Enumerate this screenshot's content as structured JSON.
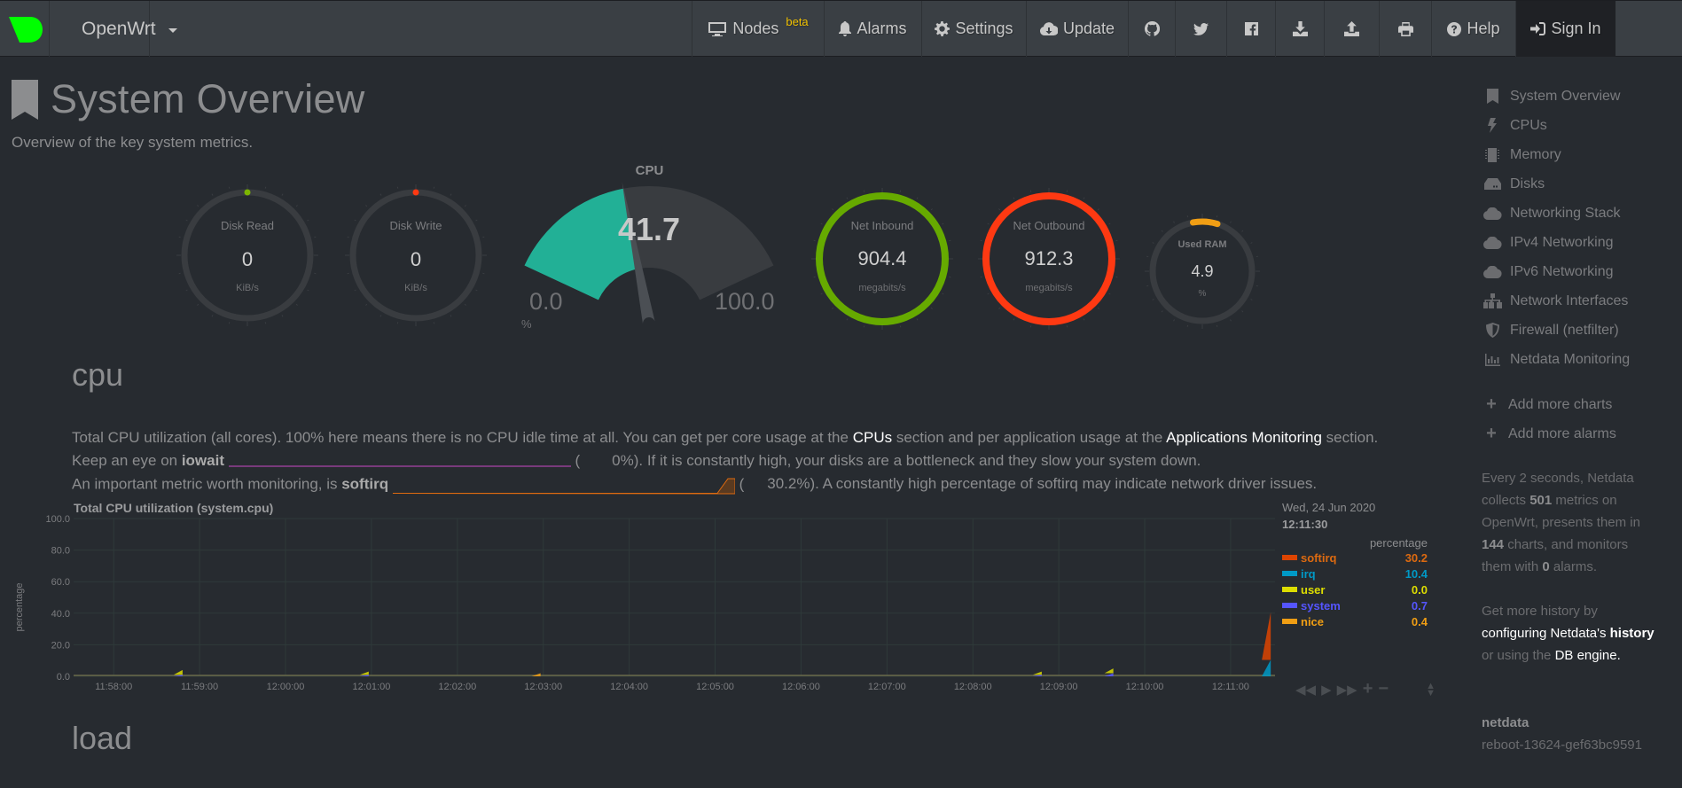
{
  "navbar": {
    "brand": "OpenWrt",
    "items": [
      {
        "label": "Nodes",
        "badge": "beta",
        "icon": "monitor-icon"
      },
      {
        "label": "Alarms",
        "icon": "bell-icon"
      },
      {
        "label": "Settings",
        "icon": "gear-icon"
      },
      {
        "label": "Update",
        "icon": "cloud-download-icon"
      },
      {
        "label": "",
        "icon": "github-icon"
      },
      {
        "label": "",
        "icon": "twitter-icon"
      },
      {
        "label": "",
        "icon": "facebook-icon"
      },
      {
        "label": "",
        "icon": "download-icon"
      },
      {
        "label": "",
        "icon": "upload-icon"
      },
      {
        "label": "",
        "icon": "print-icon"
      },
      {
        "label": "Help",
        "icon": "question-circle-icon"
      },
      {
        "label": "Sign In",
        "icon": "sign-in-icon"
      }
    ]
  },
  "page": {
    "title": "System Overview",
    "subtitle": "Overview of the key system metrics."
  },
  "gauges": {
    "disk_read": {
      "label": "Disk Read",
      "value": "0",
      "unit": "KiB/s",
      "color": "#7cb600"
    },
    "disk_write": {
      "label": "Disk Write",
      "value": "0",
      "unit": "KiB/s",
      "color": "#fe3912"
    },
    "cpu": {
      "label": "CPU",
      "value": "41.7",
      "min": "0.0",
      "max": "100.0",
      "unit": "%",
      "fraction": 0.417,
      "color": "#22b096"
    },
    "net_inbound": {
      "label": "Net Inbound",
      "value": "904.4",
      "unit": "megabits/s",
      "color": "#66aa00"
    },
    "net_outbound": {
      "label": "Net Outbound",
      "value": "912.3",
      "unit": "megabits/s",
      "color": "#fe3912"
    },
    "used_ram": {
      "label": "Used RAM",
      "value": "4.9",
      "unit": "%",
      "fraction": 0.049,
      "color": "#f09e14"
    }
  },
  "cpu_section": {
    "heading": "cpu",
    "desc_line1_a": "Total CPU utilization (all cores). 100% here means there is no CPU idle time at all. You can get per core usage at the ",
    "desc_link_cpus": "CPUs",
    "desc_line1_b": " section and per application usage at the ",
    "desc_link_apps": "Applications Monitoring",
    "desc_line1_c": " section.",
    "desc_line2_a": "Keep an eye on ",
    "desc_line2_b": "iowait",
    "desc_line2_paren_open": "(",
    "desc_line2_val": "0%). If it is constantly high, your disks are a bottleneck and they slow your system down.",
    "desc_line3_a": "An important metric worth monitoring, is ",
    "desc_line3_b": "softirq",
    "desc_line3_paren_open": "(",
    "desc_line3_val": "30.2%). A constantly high percentage of softirq may indicate network driver issues."
  },
  "chart_data": {
    "type": "area",
    "title": "Total CPU utilization (system.cpu)",
    "ylabel": "percentage",
    "xlabel": "",
    "ylim": [
      0,
      100
    ],
    "y_ticks": [
      "100.0",
      "80.0",
      "60.0",
      "40.0",
      "20.0",
      "0.0"
    ],
    "x_ticks": [
      "11:58:00",
      "11:59:00",
      "12:00:00",
      "12:01:00",
      "12:02:00",
      "12:03:00",
      "12:04:00",
      "12:05:00",
      "12:06:00",
      "12:07:00",
      "12:08:00",
      "12:09:00",
      "12:10:00",
      "12:11:00"
    ],
    "grid": true,
    "legend_position": "right",
    "legend_date": "Wed, 24 Jun 2020",
    "legend_time": "12:11:30",
    "legend_units": "percentage",
    "series": [
      {
        "name": "softirq",
        "value": "30.2",
        "color": "#dd4400"
      },
      {
        "name": "irq",
        "value": "10.4",
        "color": "#0099c6"
      },
      {
        "name": "user",
        "value": "0.0",
        "color": "#dddd00"
      },
      {
        "name": "system",
        "value": "0.7",
        "color": "#5555ff"
      },
      {
        "name": "nice",
        "value": "0.4",
        "color": "#f09e14"
      }
    ],
    "spikes": [
      {
        "x": "11:58:45",
        "user": 3,
        "system": 1
      },
      {
        "x": "12:00:55",
        "user": 2,
        "system": 1
      },
      {
        "x": "12:02:55",
        "nice": 2
      },
      {
        "x": "12:08:45",
        "user": 2,
        "system": 1
      },
      {
        "x": "12:09:35",
        "user": 3,
        "system": 2
      },
      {
        "x": "12:11:28",
        "softirq": 30.2,
        "irq": 10.4
      }
    ]
  },
  "load_section": {
    "heading": "load"
  },
  "sidebar": {
    "items": [
      {
        "label": "System Overview",
        "icon": "bookmark-icon"
      },
      {
        "label": "CPUs",
        "icon": "bolt-icon"
      },
      {
        "label": "Memory",
        "icon": "memory-chip-icon"
      },
      {
        "label": "Disks",
        "icon": "hdd-icon"
      },
      {
        "label": "Networking Stack",
        "icon": "cloud-icon"
      },
      {
        "label": "IPv4 Networking",
        "icon": "cloud-icon"
      },
      {
        "label": "IPv6 Networking",
        "icon": "cloud-icon"
      },
      {
        "label": "Network Interfaces",
        "icon": "sitemap-icon"
      },
      {
        "label": "Firewall (netfilter)",
        "icon": "shield-icon"
      },
      {
        "label": "Netdata Monitoring",
        "icon": "bar-chart-icon"
      }
    ],
    "add_charts": "Add more charts",
    "add_alarms": "Add more alarms",
    "info_1": "Every 2 seconds, Netdata collects ",
    "metrics_count": "501",
    "info_2": " metrics on OpenWrt, presents them in ",
    "charts_count": "144",
    "info_3": " charts, and monitors them with ",
    "alarms_count": "0",
    "info_4": " alarms.",
    "history_1": "Get more history by ",
    "history_link1": "configuring Netdata's ",
    "history_link1b": "history",
    "history_2": " or using the ",
    "history_link2": "DB engine",
    "history_3": ".",
    "version_label": "netdata",
    "version": "reboot-13624-gef63bc9591"
  }
}
